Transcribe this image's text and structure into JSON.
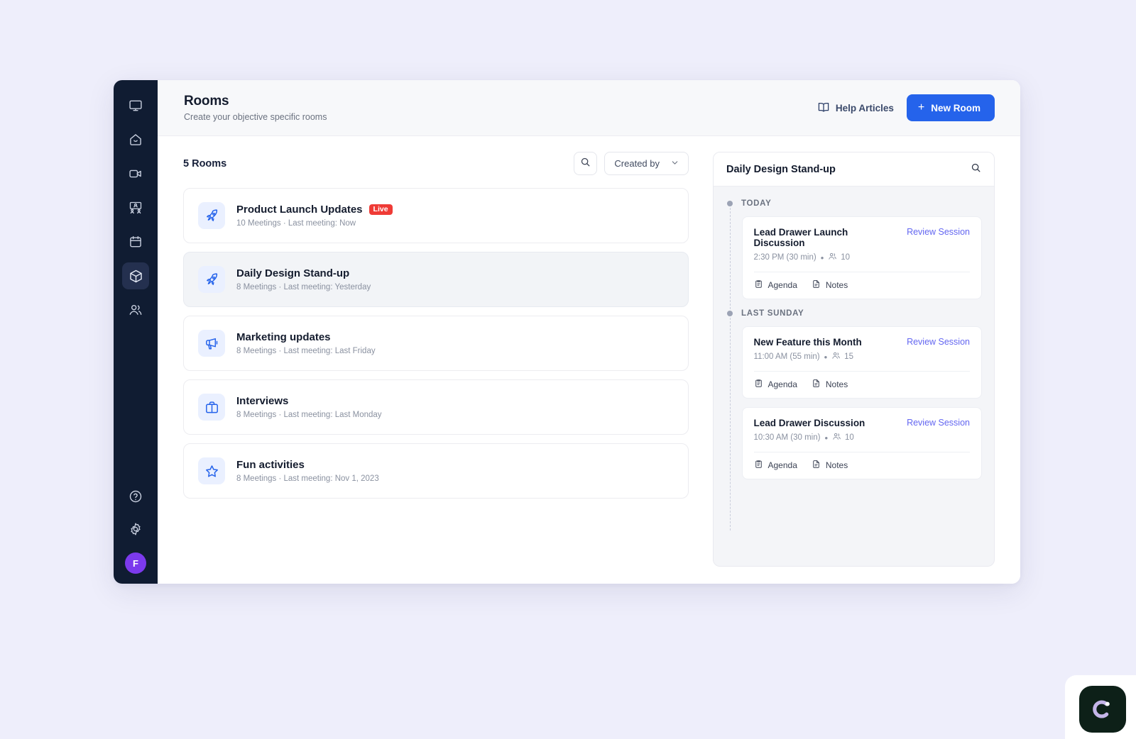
{
  "sidebar": {
    "top_items": [
      {
        "name": "monitor-icon",
        "label": "Screen"
      },
      {
        "name": "home-icon",
        "label": "Home"
      },
      {
        "name": "video-camera-icon",
        "label": "Meetings"
      },
      {
        "name": "presentation-icon",
        "label": "Team"
      },
      {
        "name": "calendar-icon",
        "label": "Calendar"
      },
      {
        "name": "cube-icon",
        "label": "Rooms"
      },
      {
        "name": "people-icon",
        "label": "Contacts"
      }
    ],
    "bottom_items": [
      {
        "name": "help-circle-icon",
        "label": "Help"
      },
      {
        "name": "gear-icon",
        "label": "Settings"
      }
    ],
    "active_index": 5,
    "avatar_initial": "F",
    "avatar_color": "#7c3aed"
  },
  "header": {
    "title": "Rooms",
    "subtitle": "Create your objective specific rooms",
    "help_label": "Help Articles",
    "new_room_label": "New Room",
    "new_room_plus": "+",
    "accent_color": "#2563eb"
  },
  "toolbar": {
    "count_label": "5 Rooms",
    "search_icon": "search-icon",
    "filter_label": "Created by",
    "chevron": "⌄"
  },
  "rooms": [
    {
      "icon": "rocket-icon",
      "title": "Product Launch Updates",
      "badge": "Live",
      "badge_color": "#ef3b36",
      "meta": "10 Meetings  ·  Last meeting: Now",
      "selected": false
    },
    {
      "icon": "rocket-icon",
      "title": "Daily Design Stand-up",
      "badge": "",
      "badge_color": "",
      "meta": "8 Meetings  ·  Last meeting: Yesterday",
      "selected": true
    },
    {
      "icon": "megaphone-icon",
      "title": "Marketing updates",
      "badge": "",
      "badge_color": "",
      "meta": "8 Meetings  ·  Last meeting: Last Friday",
      "selected": false
    },
    {
      "icon": "briefcase-icon",
      "title": "Interviews",
      "badge": "",
      "badge_color": "",
      "meta": "8 Meetings  ·  Last meeting: Last Monday",
      "selected": false
    },
    {
      "icon": "star-icon",
      "title": "Fun activities",
      "badge": "",
      "badge_color": "",
      "meta": "8 Meetings  ·  Last meeting: Nov 1, 2023",
      "selected": false
    }
  ],
  "detail": {
    "title": "Daily Design Stand-up",
    "search_icon": "search-icon",
    "review_link_color": "#6366f1",
    "groups": [
      {
        "label": "TODAY",
        "sessions": [
          {
            "title": "Lead Drawer Launch Discussion",
            "time": "2:30 PM (30 min)",
            "attendees": "10",
            "review_label": "Review Session",
            "agenda_label": "Agenda",
            "notes_label": "Notes"
          }
        ]
      },
      {
        "label": "LAST SUNDAY",
        "sessions": [
          {
            "title": "New Feature this Month",
            "time": "11:00 AM (55 min)",
            "attendees": "15",
            "review_label": "Review Session",
            "agenda_label": "Agenda",
            "notes_label": "Notes"
          },
          {
            "title": "Lead Drawer Discussion",
            "time": "10:30 AM (30 min)",
            "attendees": "10",
            "review_label": "Review Session",
            "agenda_label": "Agenda",
            "notes_label": "Notes"
          }
        ]
      }
    ]
  },
  "watermark": {
    "name": "app-logo-badge",
    "badge_color": "#0d2018",
    "arc_color": "#c4b5e8"
  }
}
